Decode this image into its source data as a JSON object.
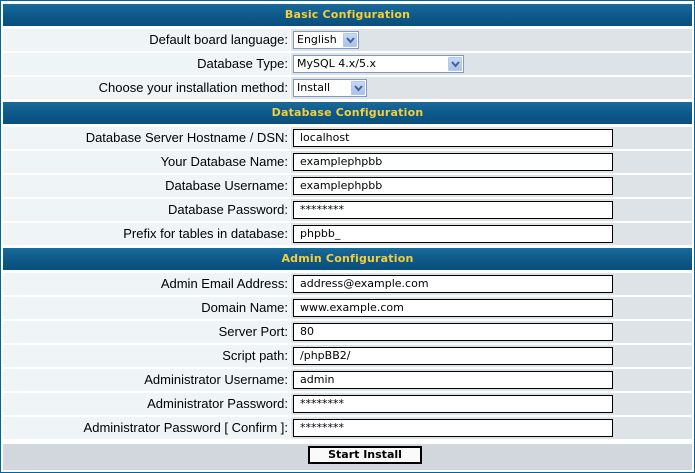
{
  "basic": {
    "header": "Basic Configuration",
    "language": {
      "label": "Default board language:",
      "value": "English"
    },
    "db_type": {
      "label": "Database Type:",
      "value": "MySQL 4.x/5.x"
    },
    "install_method": {
      "label": "Choose your installation method:",
      "value": "Install"
    }
  },
  "database": {
    "header": "Database Configuration",
    "hostname": {
      "label": "Database Server Hostname / DSN:",
      "value": "localhost"
    },
    "name": {
      "label": "Your Database Name:",
      "value": "examplephpbb"
    },
    "username": {
      "label": "Database Username:",
      "value": "examplephpbb"
    },
    "password": {
      "label": "Database Password:",
      "value": "********"
    },
    "prefix": {
      "label": "Prefix for tables in database:",
      "value": "phpbb_"
    }
  },
  "admin": {
    "header": "Admin Configuration",
    "email": {
      "label": "Admin Email Address:",
      "value": "address@example.com"
    },
    "domain": {
      "label": "Domain Name:",
      "value": "www.example.com"
    },
    "port": {
      "label": "Server Port:",
      "value": "80"
    },
    "script_path": {
      "label": "Script path:",
      "value": "/phpBB2/"
    },
    "username": {
      "label": "Administrator Username:",
      "value": "admin"
    },
    "password": {
      "label": "Administrator Password:",
      "value": "********"
    },
    "password_confirm": {
      "label": "Administrator Password [ Confirm ]:",
      "value": "********"
    }
  },
  "submit_label": "Start Install",
  "colors": {
    "header_bg": "#0c5888",
    "header_text": "#f5cf3b",
    "label_bg": "#eff4f7",
    "value_bg": "#dee3e7",
    "footer_bg": "#d1d7dc"
  }
}
